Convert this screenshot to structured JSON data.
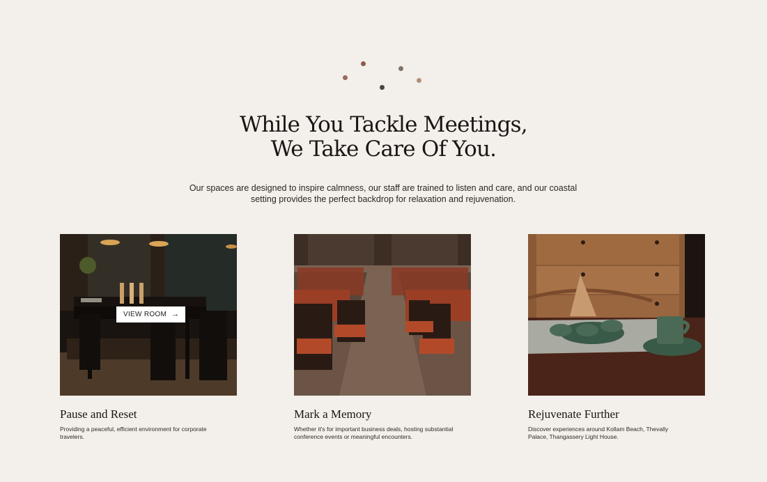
{
  "headline": {
    "line1": "While You Tackle Meetings,",
    "line2": "We Take Care Of You."
  },
  "intro": "Our spaces are designed to inspire calmness, our staff are trained to listen and care, and our coastal setting provides the perfect backdrop for relaxation and rejuvenation.",
  "cards": [
    {
      "title": "Pause and Reset",
      "description": "Providing a peaceful, efficient environment for corporate travelers.",
      "button_label": "VIEW ROOM",
      "button_icon": "arrow-right-icon"
    },
    {
      "title": "Mark a Memory",
      "description": "Whether it's for important business deals, hosting substantial conference events or meaningful encounters."
    },
    {
      "title": "Rejuvenate Further",
      "description": "Discover experiences around Kollam Beach, Thevally Palace, Thangassery Light House."
    }
  ],
  "colors": {
    "background": "#f3f0eb",
    "text": "#191613",
    "dots": [
      "#9b6a5c",
      "#8e5a4d",
      "#4a4541",
      "#7f7268",
      "#b2907c"
    ]
  }
}
